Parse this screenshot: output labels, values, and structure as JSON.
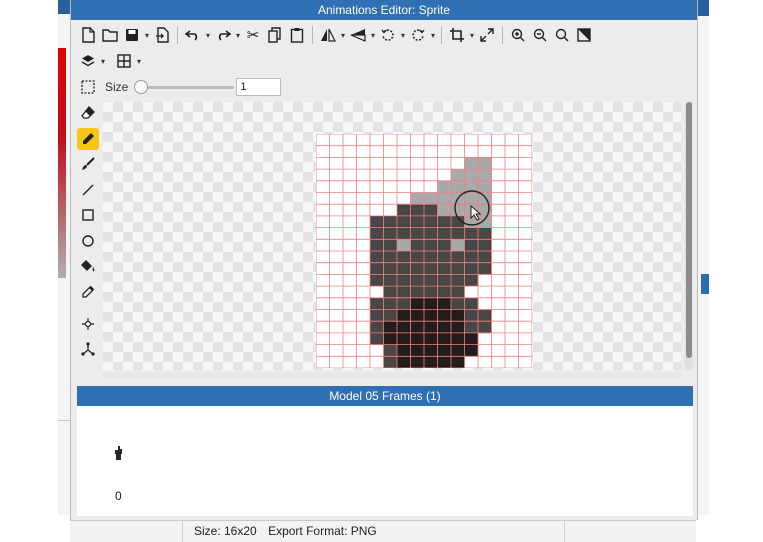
{
  "window": {
    "title": "Animations Editor: Sprite"
  },
  "toolbar": {
    "icons": [
      "new-file-icon",
      "open-folder-icon",
      "save-icon",
      "export-icon",
      "undo-icon",
      "redo-icon",
      "cut-icon",
      "copy-icon",
      "paste-icon",
      "flip-horizontal-icon",
      "flip-vertical-icon",
      "rotate-left-icon",
      "rotate-right-icon",
      "crop-icon",
      "resize-icon",
      "zoom-in-icon",
      "zoom-out-icon",
      "zoom-fit-icon",
      "invert-icon",
      "layers-icon",
      "grid-icon"
    ]
  },
  "brush": {
    "size_label": "Size",
    "size_value": "1",
    "slider_level": 0.0
  },
  "tools": [
    "selection",
    "eraser",
    "pencil",
    "brush",
    "line",
    "rectangle",
    "ellipse",
    "fill",
    "eyedropper",
    "move",
    "skeleton"
  ],
  "active_tool": "pencil",
  "canvas": {
    "grid_columns": 16,
    "grid_rows": 20,
    "colors": {
      "1": "#a9a9a9",
      "2": "#4a4646",
      "3": "#231c1c"
    },
    "pixels": [
      "0000000000000000",
      "0000000000000000",
      "0000000000011000",
      "0000000000111000",
      "0000000001111000",
      "0000000111111000",
      "0000002221111000",
      "0000222222211000",
      "0000222222222000",
      "0000221222122000",
      "0000222222222000",
      "0000222222222000",
      "0000222222220000",
      "0000022222200000",
      "0000222333220000",
      "0000223333322000",
      "0000233333322000",
      "0000233333330000",
      "0000023333330000",
      "0000023333300000"
    ],
    "grid_color": "#f08080"
  },
  "frames": {
    "header": "Model 05 Frames (1)",
    "items": [
      {
        "index": "0"
      }
    ]
  },
  "status": {
    "size": "Size: 16x20",
    "export_format": "Export Format: PNG"
  }
}
